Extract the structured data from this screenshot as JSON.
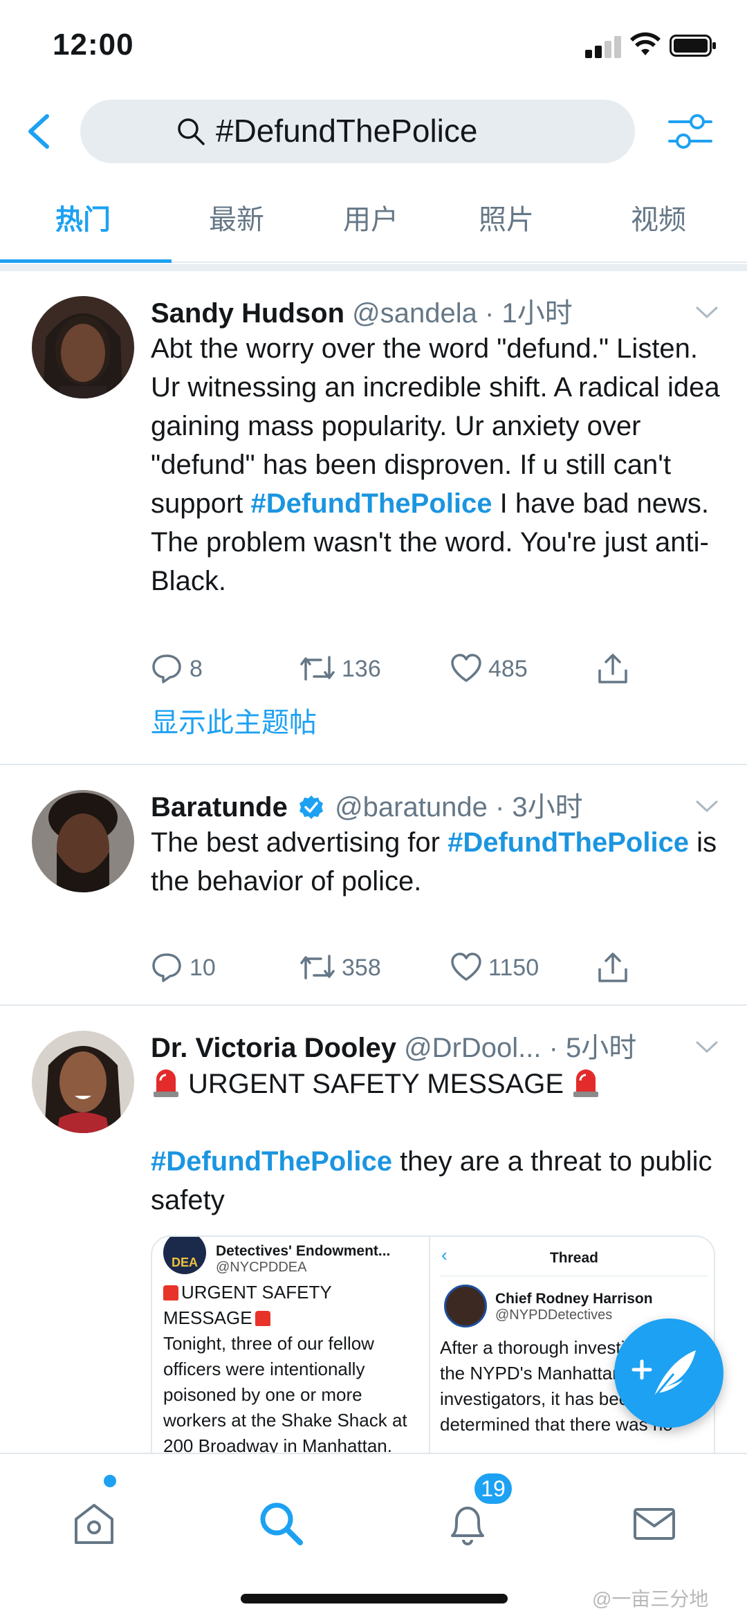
{
  "status": {
    "time": "12:00"
  },
  "search": {
    "query": "#DefundThePolice"
  },
  "tabs": [
    {
      "label": "热门",
      "active": true
    },
    {
      "label": "最新",
      "active": false
    },
    {
      "label": "用户",
      "active": false
    },
    {
      "label": "照片",
      "active": false
    },
    {
      "label": "视频",
      "active": false
    }
  ],
  "tweets": [
    {
      "name": "Sandy Hudson",
      "handle": "@sandela",
      "time": "· 1小时",
      "text_before": "Abt the worry over the word \"defund.\" Listen. Ur witnessing an incredible shift. A radical idea gaining mass popularity. Ur anxiety over \"defund\" has been disproven. If u still can't support ",
      "hashtag": "#DefundThePolice",
      "text_after": " I have bad news. The problem wasn't the word. You're just anti-Black.",
      "replies": "8",
      "retweets": "136",
      "likes": "485",
      "show_thread": "显示此主题帖"
    },
    {
      "name": "Baratunde",
      "handle": "@baratunde",
      "time": "· 3小时",
      "text_before": "The best advertising for ",
      "hashtag": "#DefundThePolice",
      "text_after": " is the behavior of police.",
      "replies": "10",
      "retweets": "358",
      "likes": "1150"
    },
    {
      "name": "Dr. Victoria Dooley",
      "handle": "@DrDool...",
      "time": "· 5小时",
      "line1": "URGENT SAFETY MESSAGE",
      "hashtag": "#DefundThePolice",
      "text_after": " they are a threat to public safety",
      "media": {
        "left_account": "Detectives' Endowment...",
        "left_handle": "@NYCPDDEA",
        "left_badge": "DEA",
        "left_heading": "URGENT SAFETY MESSAGE",
        "left_body": "Tonight, three of our fellow officers were intentionally poisoned by one or more workers at the Shake Shack at 200 Broadway in Manhattan.",
        "right_title": "Thread",
        "right_name": "Chief Rodney Harrison",
        "right_handle": "@NYPDDetectives",
        "right_body": "After a thorough investigation by the NYPD's Manhattan South investigators, it has been determined that there was no"
      }
    }
  ],
  "nav": {
    "notifications_badge": "19"
  },
  "watermark": "@一亩三分地",
  "colors": {
    "accent": "#1da1f2",
    "text": "#14171a",
    "secondary": "#657786"
  }
}
